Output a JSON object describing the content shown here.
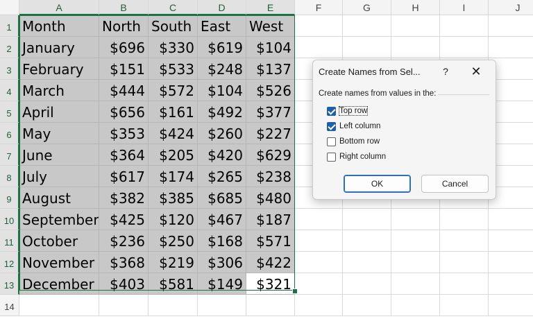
{
  "spreadsheet": {
    "columns": [
      "A",
      "B",
      "C",
      "D",
      "E",
      "F",
      "G",
      "H",
      "I",
      "J"
    ],
    "rows": [
      "1",
      "2",
      "3",
      "4",
      "5",
      "6",
      "7",
      "8",
      "9",
      "10",
      "11",
      "12",
      "13",
      "14"
    ],
    "header_row": [
      "Month",
      "North",
      "South",
      "East",
      "West"
    ],
    "data_rows": [
      [
        "January",
        "$696",
        "$330",
        "$619",
        "$104"
      ],
      [
        "February",
        "$151",
        "$533",
        "$248",
        "$137"
      ],
      [
        "March",
        "$444",
        "$572",
        "$104",
        "$526"
      ],
      [
        "April",
        "$656",
        "$161",
        "$492",
        "$377"
      ],
      [
        "May",
        "$353",
        "$424",
        "$260",
        "$227"
      ],
      [
        "June",
        "$364",
        "$205",
        "$420",
        "$629"
      ],
      [
        "July",
        "$617",
        "$174",
        "$265",
        "$238"
      ],
      [
        "August",
        "$382",
        "$385",
        "$685",
        "$480"
      ],
      [
        "September",
        "$425",
        "$120",
        "$467",
        "$187"
      ],
      [
        "October",
        "$236",
        "$250",
        "$168",
        "$571"
      ],
      [
        "November",
        "$368",
        "$219",
        "$306",
        "$422"
      ],
      [
        "December",
        "$403",
        "$581",
        "$149",
        "$321"
      ]
    ],
    "selection": "A1:E13",
    "active_cell": "E13",
    "colors": {
      "selection_border": "#1e7145",
      "selection_fill": "#c8c8c8"
    }
  },
  "dialog": {
    "title": "Create Names from Sel...",
    "help_label": "?",
    "close_icon": "close-icon",
    "group_label": "Create names from values in the:",
    "options": [
      {
        "label": "Top row",
        "checked": true
      },
      {
        "label": "Left column",
        "checked": true
      },
      {
        "label": "Bottom row",
        "checked": false
      },
      {
        "label": "Right column",
        "checked": false
      }
    ],
    "ok_label": "OK",
    "cancel_label": "Cancel"
  }
}
